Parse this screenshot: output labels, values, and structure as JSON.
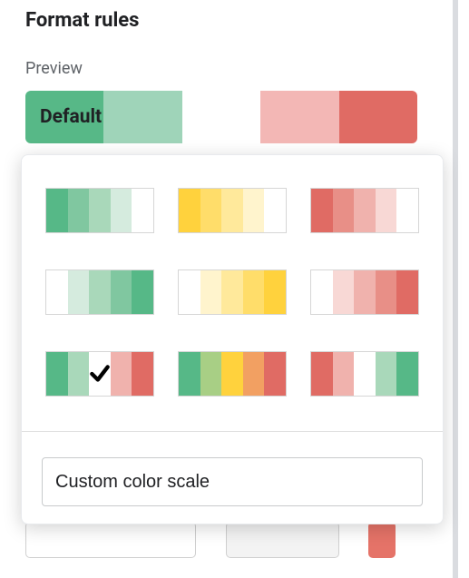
{
  "title": "Format rules",
  "preview": {
    "label": "Preview",
    "text": "Default",
    "colors": [
      "#57b887",
      "#9fd4b9",
      "#ffffff",
      "#f3b7b5",
      "#e06b64"
    ]
  },
  "selected_preset_index": 6,
  "presets": [
    {
      "colors": [
        "#56b887",
        "#80c7a0",
        "#a9d8ba",
        "#d5ebde",
        "#ffffff"
      ]
    },
    {
      "colors": [
        "#ffd23d",
        "#ffdd6a",
        "#ffe99b",
        "#fff4cd",
        "#ffffff"
      ]
    },
    {
      "colors": [
        "#e06b64",
        "#e88f87",
        "#f0b2ad",
        "#f8d8d5",
        "#ffffff"
      ]
    },
    {
      "colors": [
        "#ffffff",
        "#d5ebde",
        "#a9d8ba",
        "#80c7a0",
        "#56b887"
      ]
    },
    {
      "colors": [
        "#ffffff",
        "#fff4cd",
        "#ffe99b",
        "#ffdd6a",
        "#ffd23d"
      ]
    },
    {
      "colors": [
        "#ffffff",
        "#f8d8d5",
        "#f0b2ad",
        "#e88f87",
        "#e06b64"
      ]
    },
    {
      "colors": [
        "#56b887",
        "#a9d8ba",
        "#ffffff",
        "#f0b2ad",
        "#e06b64"
      ]
    },
    {
      "colors": [
        "#56b887",
        "#a8cf85",
        "#ffd23d",
        "#f2a062",
        "#e06b64"
      ]
    },
    {
      "colors": [
        "#e06b64",
        "#f0b2ad",
        "#ffffff",
        "#a9d8ba",
        "#56b887"
      ]
    }
  ],
  "custom_scale_label": "Custom color scale"
}
